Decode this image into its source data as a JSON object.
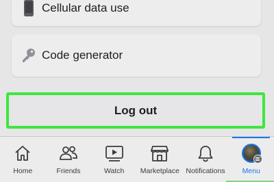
{
  "settings": {
    "cellular_label": "Cellular data use",
    "cellular_icon": "phone-icon",
    "codegen_label": "Code generator",
    "codegen_icon": "key-icon"
  },
  "logout": {
    "label": "Log out",
    "highlight_color": "#3ee63e"
  },
  "tabbar": {
    "active_color": "#1877f2",
    "tabs": [
      {
        "label": "Home",
        "icon": "home-icon",
        "active": false
      },
      {
        "label": "Friends",
        "icon": "friends-icon",
        "active": false
      },
      {
        "label": "Watch",
        "icon": "video-icon",
        "active": false
      },
      {
        "label": "Marketplace",
        "icon": "store-icon",
        "active": false
      },
      {
        "label": "Notifications",
        "icon": "bell-icon",
        "active": false
      },
      {
        "label": "Menu",
        "icon": "avatar-menu-icon",
        "active": true
      }
    ]
  }
}
